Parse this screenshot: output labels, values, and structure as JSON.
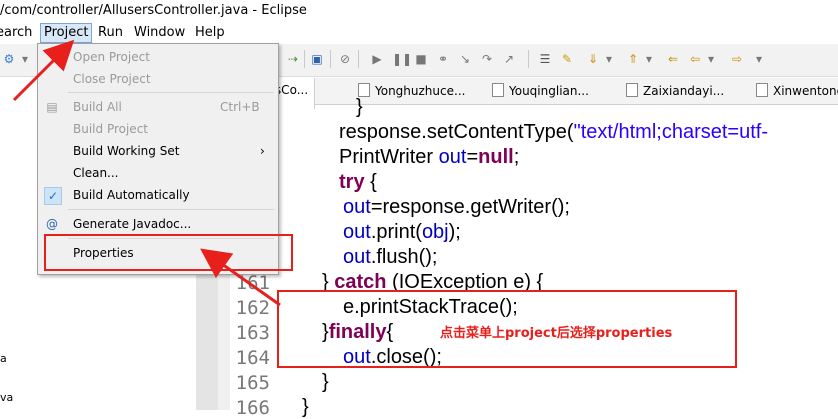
{
  "window": {
    "title": "/com/controller/AllusersController.java - Eclipse"
  },
  "menubar": {
    "items": [
      "earch",
      "Project",
      "Run",
      "Window",
      "Help"
    ]
  },
  "project_menu": {
    "items": [
      {
        "label": "Open Project",
        "enabled": false
      },
      {
        "label": "Close Project",
        "enabled": false
      },
      {
        "label": "Build All",
        "shortcut": "Ctrl+B",
        "enabled": false,
        "icon": "build-icon"
      },
      {
        "label": "Build Project",
        "enabled": false
      },
      {
        "label": "Build Working Set",
        "enabled": true,
        "submenu": true
      },
      {
        "label": "Clean...",
        "enabled": true
      },
      {
        "label": "Build Automatically",
        "enabled": true,
        "checked": true
      },
      {
        "label": "Generate Javadoc...",
        "enabled": true,
        "icon": "javadoc-icon"
      },
      {
        "label": "Properties",
        "enabled": true
      }
    ],
    "submenu_arrow": "›",
    "check_mark": "✓"
  },
  "editor_tabs": [
    {
      "label": "rsCo..."
    },
    {
      "label": "Yonghuzhuce..."
    },
    {
      "label": "Youqinglian..."
    },
    {
      "label": "Zaixiandayi..."
    },
    {
      "label": "Xinwentong"
    }
  ],
  "line_numbers": [
    "161",
    "162",
    "163",
    "164",
    "165",
    "166"
  ],
  "code": {
    "brace_top": "}",
    "l1_call": "response.setContentType(",
    "l1_str": "\"text/html;charset=utf-",
    "l2_type": "PrintWriter ",
    "l2_var": "out",
    "l2_eq": "=",
    "l2_null": "null",
    "l2_semi": ";",
    "l3_try": "try",
    "l3_brace": " {",
    "l4_var": "out",
    "l4_rest": "=response.getWriter();",
    "l5_var": "out",
    "l5_rest": ".print(",
    "l5_obj": "obj",
    "l5_end": ");",
    "l6_var": "out",
    "l6_rest": ".flush();",
    "l7_open": "} ",
    "l7_catch": "catch",
    "l7_rest": " (IOException e) {",
    "l8": "e.printStackTrace();",
    "l9_open": "}",
    "l9_finally": "finally",
    "l9_brace": "{",
    "l10_var": "out",
    "l10_rest": ".close();",
    "l11": "}",
    "l12": "}"
  },
  "left_panel": {
    "file1": "a",
    "file2": "va"
  },
  "annotation": {
    "note": "点击菜单上project后选择properties"
  },
  "colors": {
    "annotation_red": "#e8201c",
    "keyword": "#7f0055",
    "string": "#2a00ff",
    "field": "#0000c0"
  }
}
